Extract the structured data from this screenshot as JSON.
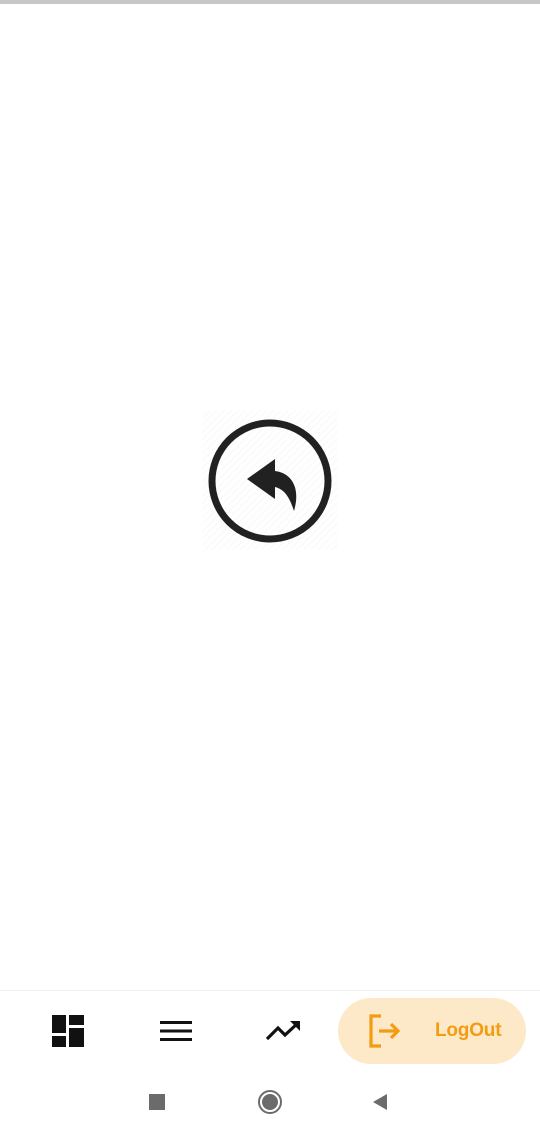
{
  "app": {
    "center_icon": "reply-arrow-circle-icon"
  },
  "bottom_nav": {
    "items": [
      {
        "id": "dashboard",
        "icon": "dashboard-icon"
      },
      {
        "id": "menu",
        "icon": "menu-icon"
      },
      {
        "id": "trends",
        "icon": "trending-up-icon"
      },
      {
        "id": "logout",
        "icon": "logout-icon",
        "label": "LogOut",
        "active": true
      }
    ]
  },
  "system_nav": {
    "items": [
      {
        "id": "recents",
        "icon": "square-icon"
      },
      {
        "id": "home",
        "icon": "circle-icon"
      },
      {
        "id": "back",
        "icon": "triangle-back-icon"
      }
    ]
  },
  "colors": {
    "accent": "#f39c12",
    "accent_bg": "#fde9c8",
    "icon_dark": "#212121",
    "system_icon": "#6b6b6b"
  }
}
